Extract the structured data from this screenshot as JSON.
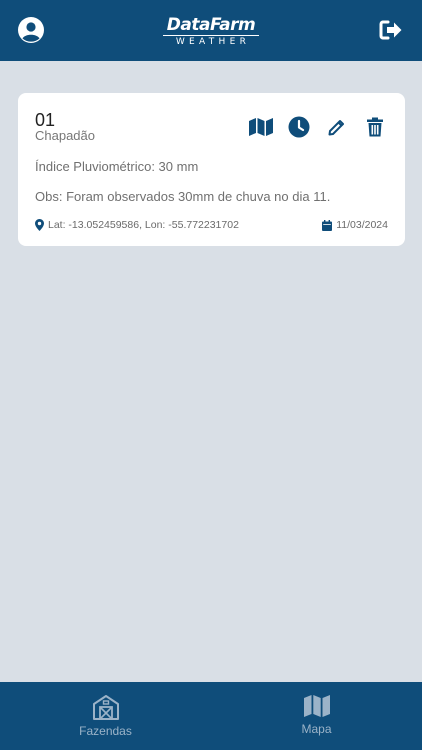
{
  "header": {
    "logo_top": "DataFarm",
    "logo_bottom": "WEATHER",
    "profile_icon": "user-circle-icon",
    "logout_icon": "sign-out-icon"
  },
  "card": {
    "number": "01",
    "name": "Chapadão",
    "rain_index": "Índice Pluviométrico: 30 mm",
    "obs": "Obs: Foram observados 30mm de chuva no dia 11.",
    "coords": "Lat: -13.052459586, Lon: -55.772231702",
    "date": "11/03/2024",
    "actions": [
      "map-icon",
      "clock-icon",
      "pencil-icon",
      "trash-icon"
    ]
  },
  "tabs": [
    {
      "label": "Fazendas",
      "icon": "barn-icon"
    },
    {
      "label": "Mapa",
      "icon": "map-icon"
    }
  ],
  "colors": {
    "brand": "#0f4d7a",
    "background": "#d9dfe6",
    "card": "#ffffff",
    "tab_inactive": "#9bb3c8"
  }
}
